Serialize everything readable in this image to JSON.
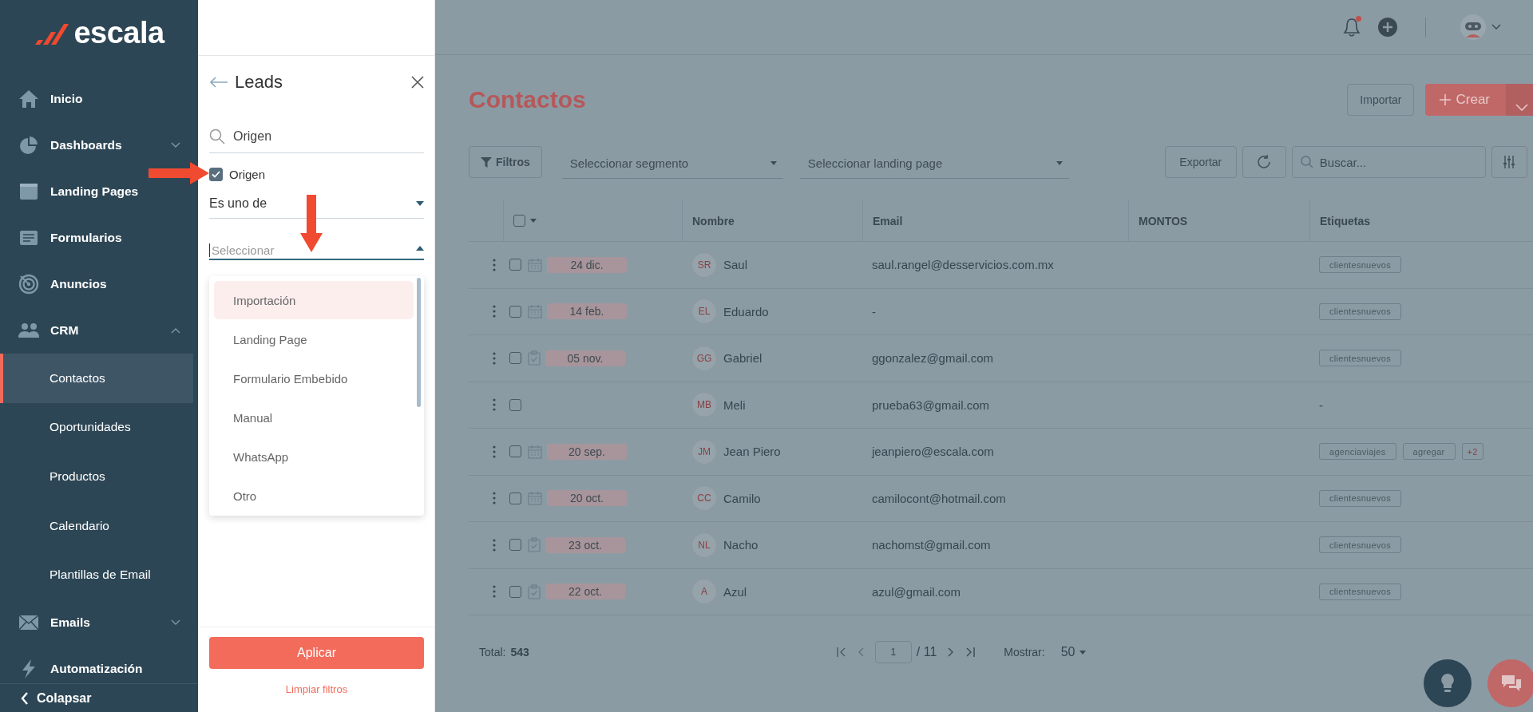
{
  "sidebar": {
    "logo": "escala",
    "items": [
      {
        "label": "Inicio"
      },
      {
        "label": "Dashboards",
        "expanded": false
      },
      {
        "label": "Landing Pages"
      },
      {
        "label": "Formularios"
      },
      {
        "label": "Anuncios"
      },
      {
        "label": "CRM",
        "expanded": true,
        "children": [
          {
            "label": "Contactos",
            "selected": true
          },
          {
            "label": "Oportunidades",
            "selected": false
          },
          {
            "label": "Productos",
            "selected": false
          },
          {
            "label": "Calendario",
            "selected": false
          },
          {
            "label": "Plantillas de Email",
            "selected": false
          }
        ]
      },
      {
        "label": "Emails",
        "expanded": false
      },
      {
        "label": "Automatización"
      }
    ],
    "collapse": "Colapsar"
  },
  "filter_panel": {
    "title": "Leads",
    "search": {
      "value": "Origen"
    },
    "field": {
      "label": "Origen",
      "checked": true
    },
    "operator": {
      "value": "Es uno de"
    },
    "value_select": {
      "placeholder": "Seleccionar",
      "expanded": true
    },
    "options": [
      {
        "label": "Importación",
        "selected": true
      },
      {
        "label": "Landing Page",
        "selected": false
      },
      {
        "label": "Formulario Embebido",
        "selected": false
      },
      {
        "label": "Manual",
        "selected": false
      },
      {
        "label": "WhatsApp",
        "selected": false
      },
      {
        "label": "Otro",
        "selected": false
      }
    ],
    "apply": "Aplicar",
    "clear": "Limpiar filtros"
  },
  "topbar": {
    "has_unread": true
  },
  "page": {
    "title": "Contactos",
    "import": "Importar",
    "create": "Crear"
  },
  "toolbar": {
    "filters": "Filtros",
    "segment": {
      "placeholder": "Seleccionar segmento"
    },
    "landing": {
      "placeholder": "Seleccionar landing page"
    },
    "export": "Exportar",
    "search": {
      "placeholder": "Buscar..."
    }
  },
  "table": {
    "select_all": {
      "checked": false
    },
    "columns": [
      "Nombre",
      "Email",
      "MONTOS",
      "Etiquetas"
    ],
    "rows": [
      {
        "checked": false,
        "kind": "calendar",
        "date": "24 dic.",
        "initials": "SR",
        "name": "Saul",
        "email": "saul.rangel@desservicios.com.mx",
        "tags": [
          "clientesnuevos"
        ]
      },
      {
        "checked": false,
        "kind": "calendar",
        "date": "14 feb.",
        "initials": "EL",
        "name": "Eduardo",
        "email": "-",
        "tags": [
          "clientesnuevos"
        ]
      },
      {
        "checked": false,
        "kind": "task",
        "date": "05 nov.",
        "initials": "GG",
        "name": "Gabriel",
        "email": "ggonzalez@gmail.com",
        "tags": [
          "clientesnuevos"
        ]
      },
      {
        "checked": false,
        "initials": "MB",
        "name": "Meli",
        "email": "prueba63@gmail.com",
        "tags_placeholder": "-"
      },
      {
        "checked": false,
        "kind": "calendar",
        "date": "20 sep.",
        "initials": "JM",
        "name": "Jean Piero",
        "email": "jeanpiero@escala.com",
        "tags": [
          "agenciaviajes",
          "agregar"
        ],
        "more": "+2"
      },
      {
        "checked": false,
        "kind": "calendar",
        "date": "20 oct.",
        "initials": "CC",
        "name": "Camilo",
        "email": "camilocont@hotmail.com",
        "tags": [
          "clientesnuevos"
        ]
      },
      {
        "checked": false,
        "kind": "task",
        "date": "23 oct.",
        "initials": "NL",
        "name": "Nacho",
        "email": "nachomst@gmail.com",
        "tags": [
          "clientesnuevos"
        ]
      },
      {
        "checked": false,
        "kind": "task",
        "date": "22 oct.",
        "initials": "A",
        "name": "Azul",
        "email": "azul@gmail.com",
        "tags": [
          "clientesnuevos"
        ]
      }
    ]
  },
  "footer": {
    "total_label": "Total:",
    "total": "543",
    "page": "1",
    "pages": "/ 11",
    "show_label": "Mostrar:",
    "per_page": "50"
  }
}
